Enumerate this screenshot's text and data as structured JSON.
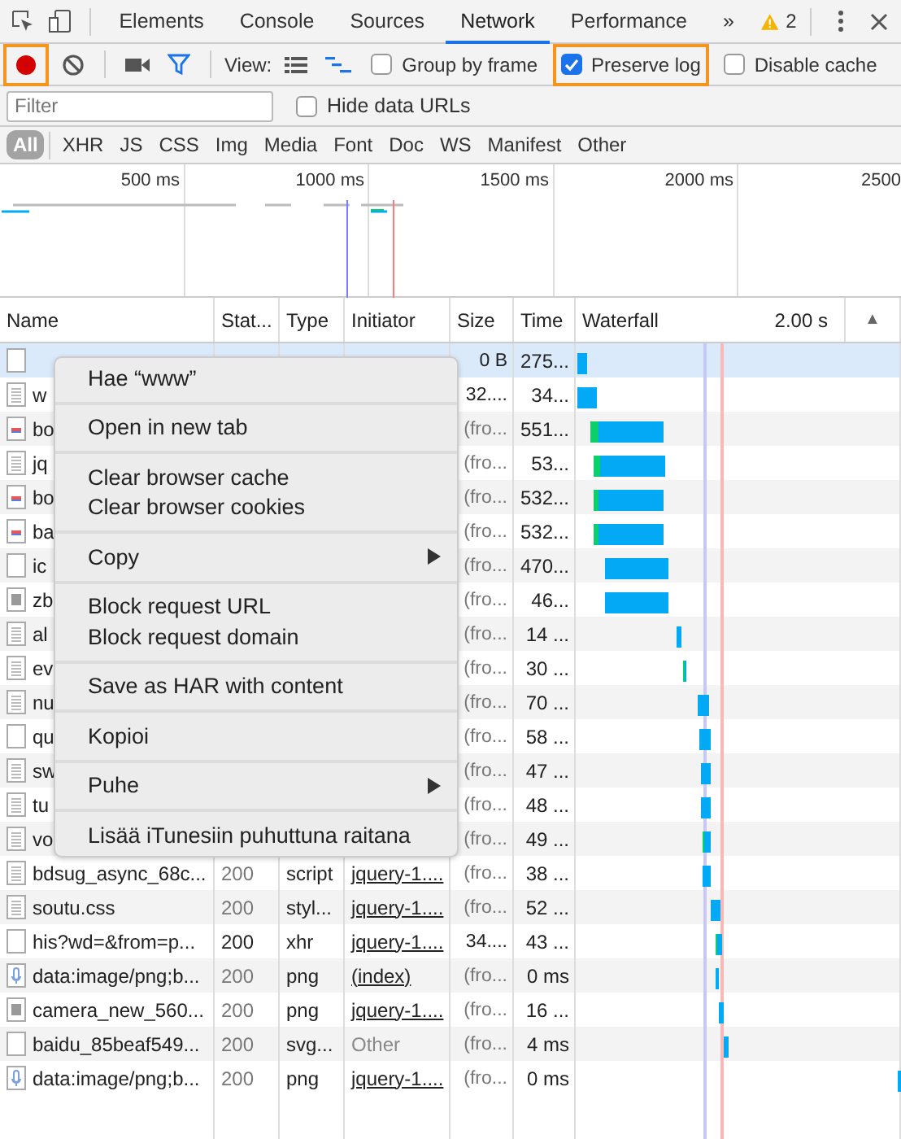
{
  "tabs": [
    {
      "label": "Elements",
      "selected": false
    },
    {
      "label": "Console",
      "selected": false
    },
    {
      "label": "Sources",
      "selected": false
    },
    {
      "label": "Network",
      "selected": true
    },
    {
      "label": "Performance",
      "selected": false
    }
  ],
  "more_tabs": "»",
  "warnings": "2",
  "toolbar": {
    "recording": true,
    "record_highlighted": true,
    "filter_active": true,
    "view_label": "View:",
    "waterfall_view": true,
    "checkboxes": [
      {
        "label": "Group by frame",
        "checked": false,
        "highlighted": false
      },
      {
        "label": "Preserve log",
        "checked": true,
        "highlighted": true
      },
      {
        "label": "Disable cache",
        "checked": false,
        "highlighted": false
      }
    ]
  },
  "filter": {
    "placeholder": "Filter",
    "hide_data_urls": {
      "label": "Hide data URLs",
      "checked": false
    }
  },
  "types": [
    {
      "label": "All",
      "selected": true
    },
    {
      "label": "XHR",
      "selected": false
    },
    {
      "label": "JS",
      "selected": false
    },
    {
      "label": "CSS",
      "selected": false
    },
    {
      "label": "Img",
      "selected": false
    },
    {
      "label": "Media",
      "selected": false
    },
    {
      "label": "Font",
      "selected": false
    },
    {
      "label": "Doc",
      "selected": false
    },
    {
      "label": "WS",
      "selected": false
    },
    {
      "label": "Manifest",
      "selected": false
    },
    {
      "label": "Other",
      "selected": false
    }
  ],
  "overview_ticks": [
    "500 ms",
    "1000 ms",
    "1500 ms",
    "2000 ms",
    "2500"
  ],
  "columns": [
    "Name",
    "Stat...",
    "Type",
    "Initiator",
    "Size",
    "Time",
    "Waterfall"
  ],
  "waterfall_scale": "2.00 s",
  "sort_indicator": "▲",
  "rows": [
    {
      "kind": "blank",
      "size": "0 B",
      "time": "275...",
      "selected": true,
      "cached": false
    },
    {
      "kind": "doc",
      "name": "w",
      "size": "32....",
      "time": "34...",
      "selected": false,
      "cached": false
    },
    {
      "kind": "image",
      "name": "bo",
      "size": "(fro...",
      "time": "551...",
      "selected": false,
      "cached": true
    },
    {
      "kind": "doc",
      "name": "jq",
      "size": "(fro...",
      "time": "53...",
      "selected": false,
      "cached": true
    },
    {
      "kind": "image",
      "name": "bo",
      "size": "(fro...",
      "time": "532...",
      "selected": false,
      "cached": true
    },
    {
      "kind": "image",
      "name": "ba",
      "size": "(fro...",
      "time": "532...",
      "selected": false,
      "cached": true
    },
    {
      "kind": "blank",
      "name": "ic",
      "size": "(fro...",
      "time": "470...",
      "selected": false,
      "cached": true
    },
    {
      "kind": "grid",
      "name": "zb",
      "size": "(fro...",
      "time": "46...",
      "selected": false,
      "cached": true
    },
    {
      "kind": "doc",
      "name": "al",
      "size": "(fro...",
      "time": "14 ...",
      "selected": false,
      "cached": true
    },
    {
      "kind": "doc",
      "name": "ev",
      "size": "(fro...",
      "time": "30 ...",
      "selected": false,
      "cached": true
    },
    {
      "kind": "doc",
      "name": "nu",
      "size": "(fro...",
      "time": "70 ...",
      "selected": false,
      "cached": true
    },
    {
      "kind": "blank",
      "name": "qu",
      "size": "(fro...",
      "time": "58 ...",
      "selected": false,
      "cached": true
    },
    {
      "kind": "doc",
      "name": "sw",
      "size": "(fro...",
      "time": "47 ...",
      "selected": false,
      "cached": true
    },
    {
      "kind": "doc",
      "name": "tu",
      "size": "(fro...",
      "time": "48 ...",
      "selected": false,
      "cached": true
    },
    {
      "kind": "doc",
      "name": "vo",
      "size": "(fro...",
      "time": "49 ...",
      "selected": false,
      "cached": true
    },
    {
      "kind": "doc",
      "name": "bdsug_async_68c...",
      "status": "200",
      "type": "script",
      "initiator": "jquery-1....",
      "initiator_link": true,
      "size": "(fro...",
      "time": "38 ...",
      "selected": false,
      "cached": true
    },
    {
      "kind": "doc",
      "name": "soutu.css",
      "status": "200",
      "type": "styl...",
      "initiator": "jquery-1....",
      "initiator_link": true,
      "size": "(fro...",
      "time": "52 ...",
      "selected": false,
      "cached": true
    },
    {
      "kind": "blank",
      "name": "his?wd=&from=p...",
      "status": "200",
      "type": "xhr",
      "initiator": "jquery-1....",
      "initiator_link": true,
      "size": "34....",
      "time": "43 ...",
      "selected": false,
      "cached": false
    },
    {
      "kind": "mic",
      "name": "data:image/png;b...",
      "status": "200",
      "type": "png",
      "initiator": "(index)",
      "initiator_link": true,
      "size": "(fro...",
      "time": "0 ms",
      "selected": false,
      "cached": true
    },
    {
      "kind": "grid",
      "name": "camera_new_560...",
      "status": "200",
      "type": "png",
      "initiator": "jquery-1....",
      "initiator_link": true,
      "size": "(fro...",
      "time": "16 ...",
      "selected": false,
      "cached": true
    },
    {
      "kind": "blank",
      "name": "baidu_85beaf549...",
      "status": "200",
      "type": "svg...",
      "initiator": "Other",
      "initiator_link": false,
      "size": "(fro...",
      "time": "4 ms",
      "selected": false,
      "cached": true
    },
    {
      "kind": "mic",
      "name": "data:image/png;b...",
      "status": "200",
      "type": "png",
      "initiator": "jquery-1....",
      "initiator_link": true,
      "size": "(fro...",
      "time": "0 ms",
      "selected": false,
      "cached": true
    }
  ],
  "context_menu": [
    [
      {
        "label": "Hae “www”",
        "submenu": false
      }
    ],
    [
      {
        "label": "Open in new tab",
        "submenu": false
      }
    ],
    [
      {
        "label": "Clear browser cache",
        "submenu": false
      },
      {
        "label": "Clear browser cookies",
        "submenu": false
      }
    ],
    [
      {
        "label": "Copy",
        "submenu": true
      }
    ],
    [
      {
        "label": "Block request URL",
        "submenu": false
      },
      {
        "label": "Block request domain",
        "submenu": false
      }
    ],
    [
      {
        "label": "Save as HAR with content",
        "submenu": false
      }
    ],
    [
      {
        "label": "Kopioi",
        "submenu": false
      }
    ],
    [
      {
        "label": "Puhe",
        "submenu": true
      }
    ],
    [
      {
        "label": "Lisää iTunesiin puhuttuna raitana",
        "submenu": false
      }
    ]
  ]
}
